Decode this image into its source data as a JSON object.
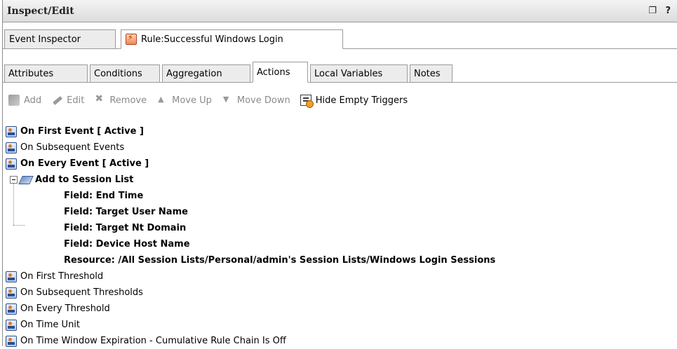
{
  "window": {
    "title": "Inspect/Edit",
    "title_controls": "❐ ?"
  },
  "outer_tabs": [
    {
      "label": "Event Inspector"
    },
    {
      "label": "Rule:Successful Windows Login",
      "icon": "rule-lightning-icon"
    }
  ],
  "inner_tabs": [
    {
      "label": "Attributes"
    },
    {
      "label": "Conditions"
    },
    {
      "label": "Aggregation"
    },
    {
      "label": "Actions"
    },
    {
      "label": "Local Variables"
    },
    {
      "label": "Notes"
    }
  ],
  "toolbar": {
    "add": "Add",
    "edit": "Edit",
    "remove": "Remove",
    "move_up": "Move Up",
    "move_down": "Move Down",
    "hide_empty": "Hide Empty Triggers"
  },
  "tree": {
    "on_first_event": "On First Event [ Active ]",
    "on_subsequent_events": "On Subsequent Events",
    "on_every_event": "On Every Event [ Active ]",
    "add_to_session_list": "Add to Session List",
    "field_end_time": "Field: End Time",
    "field_target_user": "Field: Target User Name",
    "field_target_nt": "Field: Target Nt Domain",
    "field_device_host": "Field: Device Host Name",
    "resource": "Resource: /All Session Lists/Personal/admin's Session Lists/Windows Login Sessions",
    "on_first_threshold": "On First Threshold",
    "on_subsequent_thresholds": "On Subsequent Thresholds",
    "on_every_threshold": "On Every Threshold",
    "on_time_unit": "On Time Unit",
    "on_time_window": "On Time Window Expiration - Cumulative Rule Chain Is Off"
  }
}
